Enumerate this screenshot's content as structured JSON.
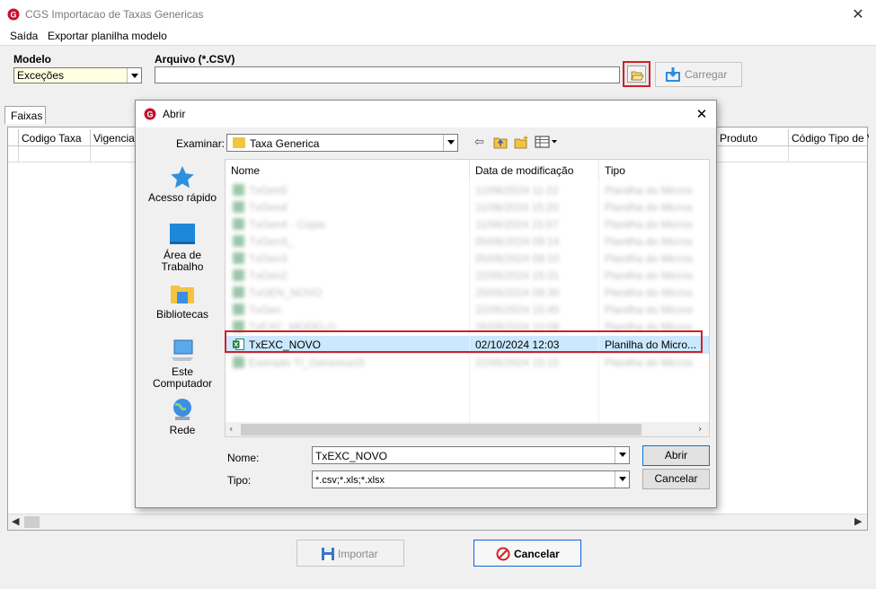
{
  "window": {
    "title": "CGS Importacao de Taxas Genericas",
    "close_glyph": "✕",
    "menu": [
      "Saída",
      "Exportar planilha modelo"
    ]
  },
  "form": {
    "modelo_label": "Modelo",
    "modelo_value": "Exceções",
    "arquivo_label": "Arquivo (*.CSV)",
    "arquivo_value": "",
    "carregar_label": "Carregar",
    "tab_label": "Faixas"
  },
  "grid": {
    "columns": [
      "Codigo Taxa",
      "Vigencia",
      "Produto",
      "Código Tipo de Ve"
    ]
  },
  "footer": {
    "importar_label": "Importar",
    "cancelar_label": "Cancelar"
  },
  "dialog": {
    "title": "Abrir",
    "close_glyph": "✕",
    "examinar_label": "Examinar:",
    "examinar_value": "Taxa Generica",
    "places": [
      "Acesso rápido",
      "Área de Trabalho",
      "Bibliotecas",
      "Este Computador",
      "Rede"
    ],
    "columns": [
      "Nome",
      "Data de modificação",
      "Tipo"
    ],
    "files": [
      {
        "name": "TxGen5",
        "date": "12/06/2024 11:22",
        "type": "Planilha do Micros",
        "blurred": true
      },
      {
        "name": "TxGen4",
        "date": "11/06/2024 15:20",
        "type": "Planilha do Micros",
        "blurred": true
      },
      {
        "name": "TxGen4 - Copia",
        "date": "11/06/2024 15:07",
        "type": "Planilha do Micros",
        "blurred": true
      },
      {
        "name": "TxGen3_",
        "date": "05/06/2024 09:14",
        "type": "Planilha do Micros",
        "blurred": true
      },
      {
        "name": "TxGen3",
        "date": "05/06/2024 09:10",
        "type": "Planilha do Micros",
        "blurred": true
      },
      {
        "name": "TxGen2",
        "date": "22/05/2024 15:31",
        "type": "Planilha do Micros",
        "blurred": true
      },
      {
        "name": "TxGEN_NOVO",
        "date": "20/05/2024 09:30",
        "type": "Planilha do Micros",
        "blurred": true
      },
      {
        "name": "TxGen",
        "date": "22/05/2024 15:45",
        "type": "Planilha do Micros",
        "blurred": true
      },
      {
        "name": "TxEXC_MODELO",
        "date": "26/09/2024 10:09",
        "type": "Planilha do Micros",
        "blurred": true
      },
      {
        "name": "TxEXC_NOVO",
        "date": "02/10/2024 12:03",
        "type": "Planilha do Micro...",
        "blurred": false
      },
      {
        "name": "Exemplo TI_Generica15",
        "date": "22/05/2024 15:15",
        "type": "Planilha do Micros",
        "blurred": true
      }
    ],
    "nome_label": "Nome:",
    "nome_value": "TxEXC_NOVO",
    "tipo_label": "Tipo:",
    "tipo_value": "*.csv;*.xls;*.xlsx",
    "abrir_label": "Abrir",
    "cancelar_label": "Cancelar"
  },
  "colors": {
    "highlight_red": "#d0202a",
    "selection_blue": "#cce8ff",
    "brand_red": "#c8102e"
  }
}
